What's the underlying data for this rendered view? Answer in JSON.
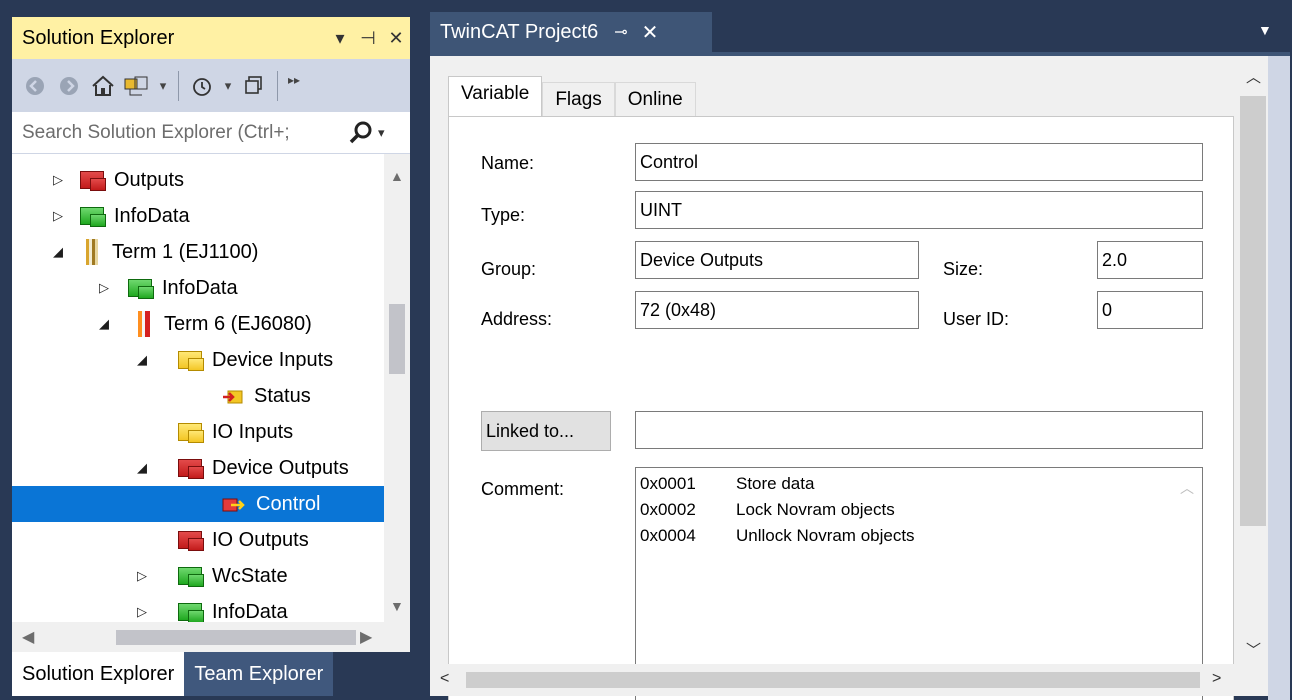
{
  "solution_explorer": {
    "title": "Solution Explorer",
    "search_placeholder": "Search Solution Explorer (Ctrl+;",
    "tree": [
      {
        "label": "Outputs",
        "icon": "folder-red",
        "expander": "▷"
      },
      {
        "label": "InfoData",
        "icon": "folder-green",
        "expander": "▷"
      },
      {
        "label": "Term 1 (EJ1100)",
        "icon": "terminal-icon",
        "expander": "◢"
      },
      {
        "label": "InfoData",
        "icon": "folder-green",
        "expander": "▷"
      },
      {
        "label": "Term 6 (EJ6080)",
        "icon": "terminal-icon",
        "expander": "◢"
      },
      {
        "label": "Device Inputs",
        "icon": "folder-yellow",
        "expander": "◢"
      },
      {
        "label": "Status",
        "icon": "input-variable-icon",
        "expander": ""
      },
      {
        "label": "IO Inputs",
        "icon": "folder-yellow",
        "expander": ""
      },
      {
        "label": "Device Outputs",
        "icon": "folder-red",
        "expander": "◢"
      },
      {
        "label": "Control",
        "icon": "output-variable-icon",
        "expander": "",
        "selected": true
      },
      {
        "label": "IO Outputs",
        "icon": "folder-red",
        "expander": ""
      },
      {
        "label": "WcState",
        "icon": "folder-green",
        "expander": "▷"
      },
      {
        "label": "InfoData",
        "icon": "folder-green",
        "expander": "▷"
      }
    ],
    "bottom_tabs": {
      "active": "Solution Explorer",
      "inactive": "Team Explorer"
    }
  },
  "document": {
    "tab_title": "TwinCAT Project6",
    "tabs": {
      "variable": "Variable",
      "flags": "Flags",
      "online": "Online"
    },
    "fields": {
      "name_label": "Name:",
      "name_value": "Control",
      "type_label": "Type:",
      "type_value": "UINT",
      "group_label": "Group:",
      "group_value": "Device Outputs",
      "size_label": "Size:",
      "size_value": "2.0",
      "address_label": "Address:",
      "address_value": "72 (0x48)",
      "user_id_label": "User ID:",
      "user_id_value": "0",
      "linked_button": "Linked to...",
      "linked_value": "",
      "comment_label": "Comment:"
    },
    "comment_lines": [
      {
        "code": "0x0001",
        "text": "Store data"
      },
      {
        "code": "0x0002",
        "text": "Lock Novram objects"
      },
      {
        "code": "0x0004",
        "text": "Unllock Novram objects"
      }
    ]
  }
}
